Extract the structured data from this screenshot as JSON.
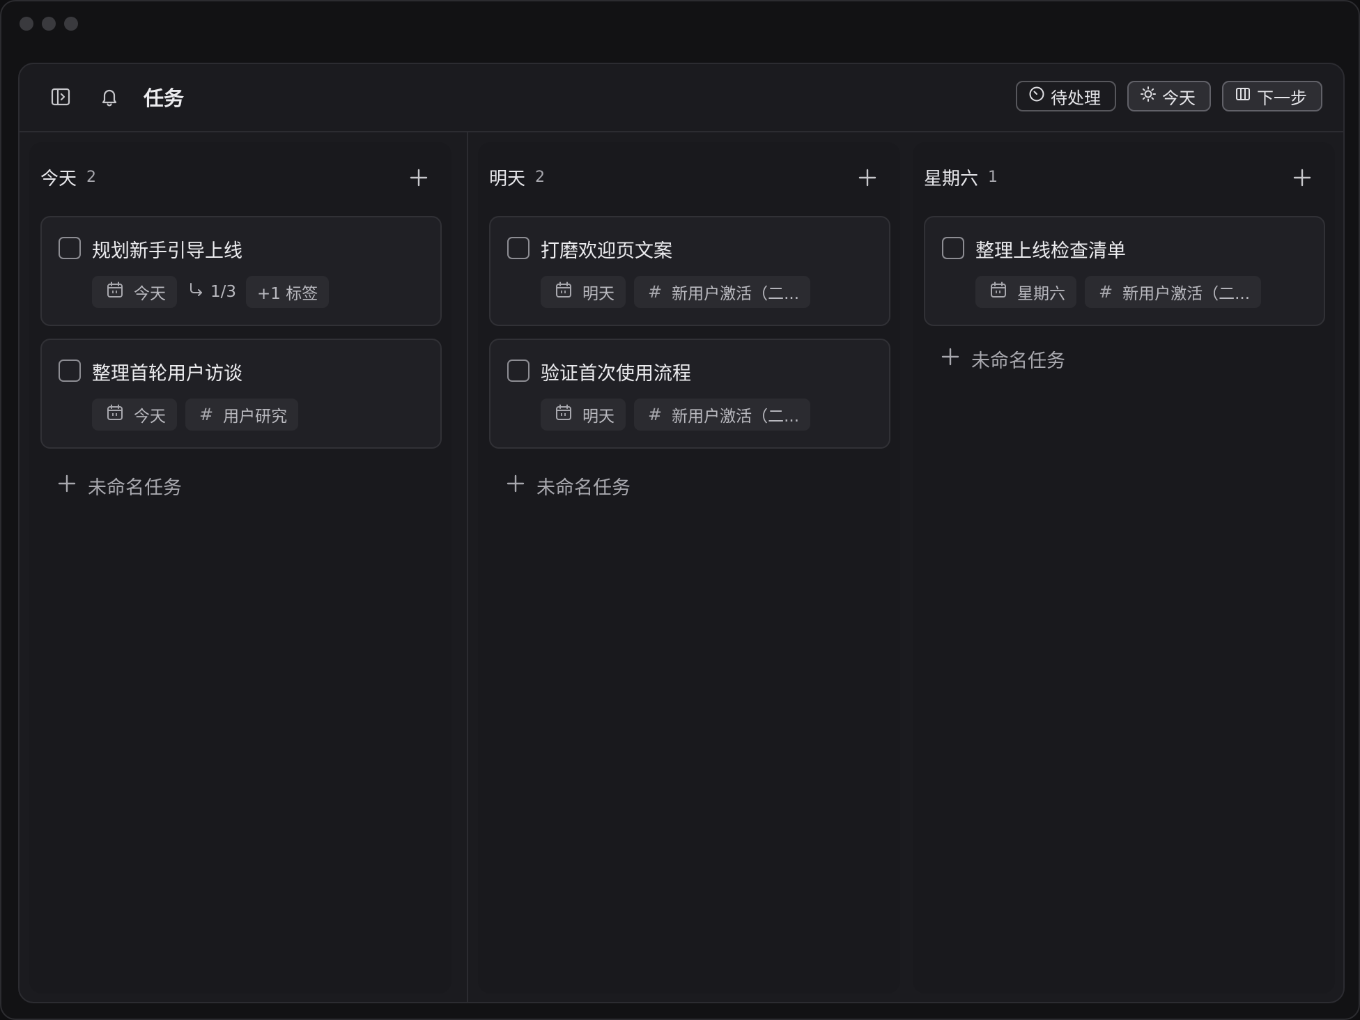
{
  "header": {
    "title": "任务",
    "buttons": [
      {
        "label": "待处理",
        "icon": "clock-icon"
      },
      {
        "label": "今天",
        "icon": "sun-icon"
      },
      {
        "label": "下一步",
        "icon": "columns-icon"
      }
    ]
  },
  "columns": [
    {
      "title": "今天",
      "count": "2",
      "cards": [
        {
          "title": "规划新手引导上线",
          "date": "今天",
          "subtasks": "1/3",
          "tag": "+1 标签"
        },
        {
          "title": "整理首轮用户访谈",
          "date": "今天",
          "tag": "用户研究"
        }
      ],
      "add_label": "未命名任务"
    },
    {
      "title": "明天",
      "count": "2",
      "cards": [
        {
          "title": "打磨欢迎页文案",
          "date": "明天",
          "tag": "新用户激活（二..."
        },
        {
          "title": "验证首次使用流程",
          "date": "明天",
          "tag": "新用户激活（二..."
        }
      ],
      "add_label": "未命名任务"
    },
    {
      "title": "星期六",
      "count": "1",
      "cards": [
        {
          "title": "整理上线检查清单",
          "date": "星期六",
          "tag": "新用户激活（二..."
        }
      ],
      "add_label": "未命名任务"
    }
  ],
  "colors": {
    "background": "#121214",
    "panel": "#1b1b1f",
    "card": "#202025",
    "chip": "#2b2b30",
    "text": "#ececef",
    "muted": "#a9a9af"
  }
}
